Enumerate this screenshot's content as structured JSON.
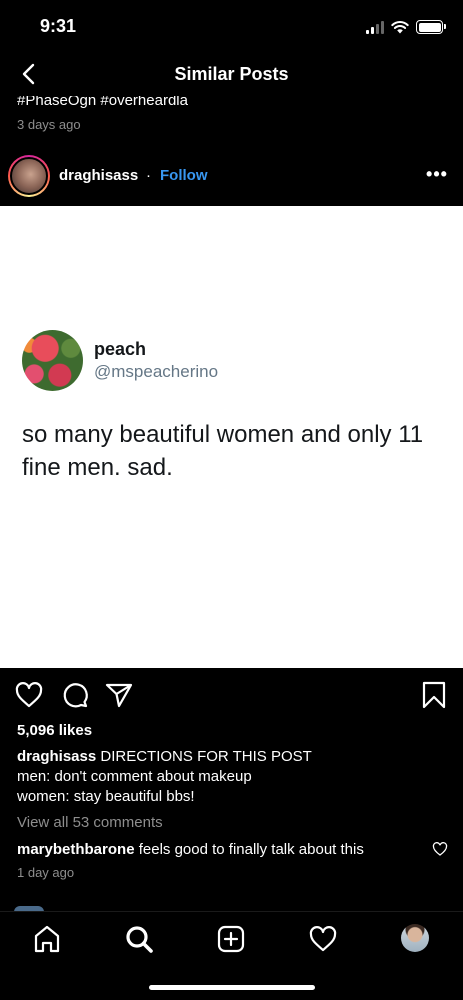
{
  "status_bar": {
    "time": "9:31"
  },
  "nav": {
    "title": "Similar Posts"
  },
  "previous_post": {
    "hashtags": "#PhaseOgn #overheardla",
    "time_ago": "3 days ago"
  },
  "post": {
    "username": "draghisass",
    "separator": "·",
    "follow_label": "Follow",
    "more_label": "•••",
    "likes": "5,096 likes",
    "caption_user": "draghisass",
    "caption_lines": [
      "DIRECTIONS FOR THIS POST",
      "men: don't comment about makeup",
      "women: stay beautiful bbs!"
    ],
    "view_comments": "View all 53 comments",
    "comment": {
      "user": "marybethbarone",
      "text": "feels good to finally talk about this"
    },
    "time_ago": "1 day ago"
  },
  "tweet": {
    "name": "peach",
    "handle": "@mspeacherino",
    "text": "so many beautiful women and only 11 fine men. sad."
  },
  "icons": {
    "back": "chevron-left-icon",
    "like": "heart-icon",
    "comment": "comment-bubble-icon",
    "share": "paper-plane-icon",
    "save": "bookmark-icon",
    "more": "ellipsis-icon",
    "tabs": [
      "home-icon",
      "search-icon",
      "add-post-icon",
      "activity-heart-icon",
      "profile-avatar"
    ]
  },
  "colors": {
    "follow": "#3897f0",
    "secondary_text": "#8e8e8e",
    "tweet_handle": "#657786",
    "background": "#000000",
    "tweet_background": "#ffffff"
  }
}
